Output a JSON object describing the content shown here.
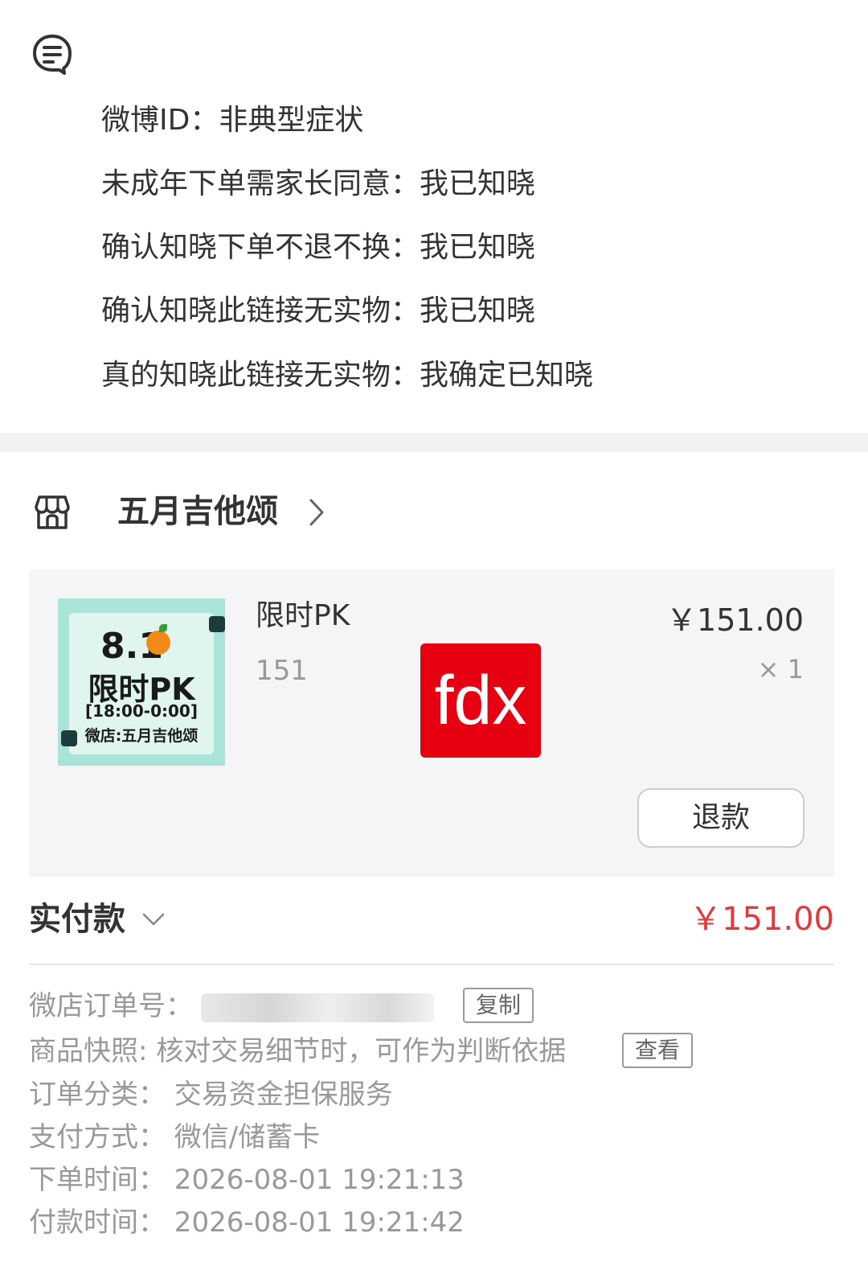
{
  "remarks": [
    "微博ID：非典型症状",
    "未成年下单需家长同意：我已知晓",
    "确认知晓下单不退不换：我已知晓",
    "确认知晓此链接无实物：我已知晓",
    "真的知晓此链接无实物：我确定已知晓"
  ],
  "shop": {
    "name": "五月吉他颂",
    "icon": "shop-icon",
    "chevron": "chevron-right-icon"
  },
  "item": {
    "thumb_lines": [
      "8.1",
      "限时PK",
      "[18:00-0:00]",
      "微店:五月吉他颂"
    ],
    "title": "限时PK",
    "sku": "151",
    "price": "￥151.00",
    "qty": "× 1",
    "refund_label": "退款"
  },
  "overlay_logo": {
    "text": "fdx",
    "color": "#e60012"
  },
  "payment": {
    "label": "实付款",
    "amount": "￥151.00",
    "amount_color": "#e4393c"
  },
  "details": {
    "order_no_label": "微店订单号：",
    "copy_label": "复制",
    "snapshot_text": "商品快照: 核对交易细节时，可作为判断依据",
    "view_label": "查看",
    "category": "订单分类：  交易资金担保服务",
    "pay_method": "支付方式：  微信/储蓄卡",
    "order_time": "下单时间：  2026-08-01 19:21:13",
    "pay_time": "付款时间：  2026-08-01 19:21:42"
  }
}
